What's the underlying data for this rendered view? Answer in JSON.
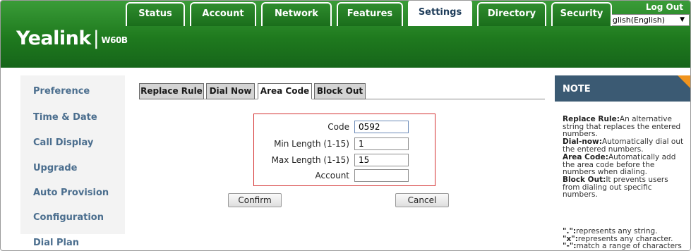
{
  "header": {
    "logo": "Yealink",
    "logo_sep": "|",
    "model": "W60B",
    "logout": "Log Out",
    "language": "English(English)"
  },
  "tabs": [
    {
      "label": "Status"
    },
    {
      "label": "Account"
    },
    {
      "label": "Network"
    },
    {
      "label": "Features"
    },
    {
      "label": "Settings",
      "active": true
    },
    {
      "label": "Directory"
    },
    {
      "label": "Security"
    }
  ],
  "sidebar": {
    "items": [
      {
        "label": "Preference"
      },
      {
        "label": "Time & Date"
      },
      {
        "label": "Call Display"
      },
      {
        "label": "Upgrade"
      },
      {
        "label": "Auto Provision"
      },
      {
        "label": "Configuration"
      },
      {
        "label": "Dial Plan",
        "active": true
      }
    ]
  },
  "subtabs": [
    {
      "label": "Replace Rule"
    },
    {
      "label": "Dial Now"
    },
    {
      "label": "Area Code",
      "active": true
    },
    {
      "label": "Block Out"
    }
  ],
  "form": {
    "code_label": "Code",
    "code_value": "0592",
    "min_label": "Min Length (1-15)",
    "min_value": "1",
    "max_label": "Max Length (1-15)",
    "max_value": "15",
    "account_label": "Account",
    "account_value": "",
    "confirm": "Confirm",
    "cancel": "Cancel"
  },
  "note": {
    "title": "NOTE",
    "replace_term": "Replace Rule:",
    "replace_desc_1": "An alternative",
    "replace_desc_2": "string that replaces the entered",
    "replace_desc_3": "numbers.",
    "dialnow_term": "Dial-now:",
    "dialnow_desc_1": "Automatically dial out",
    "dialnow_desc_2": "the entered numbers.",
    "area_term": "Area Code:",
    "area_desc_1": "Automatically add",
    "area_desc_2": "the area code before the",
    "area_desc_3": "numbers when dialing.",
    "block_term": "Block Out:",
    "block_desc_1": "It prevents users",
    "block_desc_2": "from dialing out specific",
    "block_desc_3": "numbers.",
    "dot_term": "\".\":",
    "dot_desc": "represents any string.",
    "x_term": "\"x\":",
    "x_desc": "represents any character.",
    "dash_term": "\"-\":",
    "dash_desc": "match a range of characters"
  },
  "colors": {
    "header_green": "#1f7a1e",
    "menu_text": "#4b6e8e",
    "note_header": "#3b5a73",
    "note_corner": "#f0941e",
    "highlight_box": "#d43030"
  }
}
